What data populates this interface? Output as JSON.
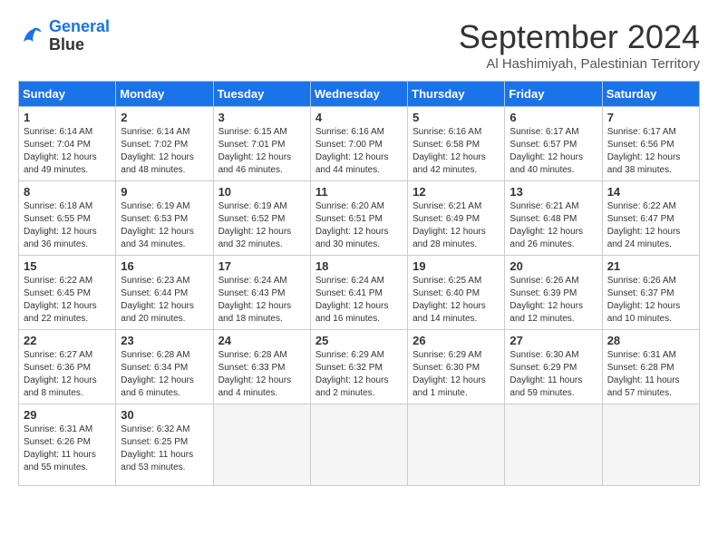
{
  "logo": {
    "line1": "General",
    "line2": "Blue"
  },
  "title": "September 2024",
  "subtitle": "Al Hashimiyah, Palestinian Territory",
  "headers": [
    "Sunday",
    "Monday",
    "Tuesday",
    "Wednesday",
    "Thursday",
    "Friday",
    "Saturday"
  ],
  "weeks": [
    [
      {
        "day": "1",
        "sunrise": "Sunrise: 6:14 AM",
        "sunset": "Sunset: 7:04 PM",
        "daylight": "Daylight: 12 hours and 49 minutes."
      },
      {
        "day": "2",
        "sunrise": "Sunrise: 6:14 AM",
        "sunset": "Sunset: 7:02 PM",
        "daylight": "Daylight: 12 hours and 48 minutes."
      },
      {
        "day": "3",
        "sunrise": "Sunrise: 6:15 AM",
        "sunset": "Sunset: 7:01 PM",
        "daylight": "Daylight: 12 hours and 46 minutes."
      },
      {
        "day": "4",
        "sunrise": "Sunrise: 6:16 AM",
        "sunset": "Sunset: 7:00 PM",
        "daylight": "Daylight: 12 hours and 44 minutes."
      },
      {
        "day": "5",
        "sunrise": "Sunrise: 6:16 AM",
        "sunset": "Sunset: 6:58 PM",
        "daylight": "Daylight: 12 hours and 42 minutes."
      },
      {
        "day": "6",
        "sunrise": "Sunrise: 6:17 AM",
        "sunset": "Sunset: 6:57 PM",
        "daylight": "Daylight: 12 hours and 40 minutes."
      },
      {
        "day": "7",
        "sunrise": "Sunrise: 6:17 AM",
        "sunset": "Sunset: 6:56 PM",
        "daylight": "Daylight: 12 hours and 38 minutes."
      }
    ],
    [
      {
        "day": "8",
        "sunrise": "Sunrise: 6:18 AM",
        "sunset": "Sunset: 6:55 PM",
        "daylight": "Daylight: 12 hours and 36 minutes."
      },
      {
        "day": "9",
        "sunrise": "Sunrise: 6:19 AM",
        "sunset": "Sunset: 6:53 PM",
        "daylight": "Daylight: 12 hours and 34 minutes."
      },
      {
        "day": "10",
        "sunrise": "Sunrise: 6:19 AM",
        "sunset": "Sunset: 6:52 PM",
        "daylight": "Daylight: 12 hours and 32 minutes."
      },
      {
        "day": "11",
        "sunrise": "Sunrise: 6:20 AM",
        "sunset": "Sunset: 6:51 PM",
        "daylight": "Daylight: 12 hours and 30 minutes."
      },
      {
        "day": "12",
        "sunrise": "Sunrise: 6:21 AM",
        "sunset": "Sunset: 6:49 PM",
        "daylight": "Daylight: 12 hours and 28 minutes."
      },
      {
        "day": "13",
        "sunrise": "Sunrise: 6:21 AM",
        "sunset": "Sunset: 6:48 PM",
        "daylight": "Daylight: 12 hours and 26 minutes."
      },
      {
        "day": "14",
        "sunrise": "Sunrise: 6:22 AM",
        "sunset": "Sunset: 6:47 PM",
        "daylight": "Daylight: 12 hours and 24 minutes."
      }
    ],
    [
      {
        "day": "15",
        "sunrise": "Sunrise: 6:22 AM",
        "sunset": "Sunset: 6:45 PM",
        "daylight": "Daylight: 12 hours and 22 minutes."
      },
      {
        "day": "16",
        "sunrise": "Sunrise: 6:23 AM",
        "sunset": "Sunset: 6:44 PM",
        "daylight": "Daylight: 12 hours and 20 minutes."
      },
      {
        "day": "17",
        "sunrise": "Sunrise: 6:24 AM",
        "sunset": "Sunset: 6:43 PM",
        "daylight": "Daylight: 12 hours and 18 minutes."
      },
      {
        "day": "18",
        "sunrise": "Sunrise: 6:24 AM",
        "sunset": "Sunset: 6:41 PM",
        "daylight": "Daylight: 12 hours and 16 minutes."
      },
      {
        "day": "19",
        "sunrise": "Sunrise: 6:25 AM",
        "sunset": "Sunset: 6:40 PM",
        "daylight": "Daylight: 12 hours and 14 minutes."
      },
      {
        "day": "20",
        "sunrise": "Sunrise: 6:26 AM",
        "sunset": "Sunset: 6:39 PM",
        "daylight": "Daylight: 12 hours and 12 minutes."
      },
      {
        "day": "21",
        "sunrise": "Sunrise: 6:26 AM",
        "sunset": "Sunset: 6:37 PM",
        "daylight": "Daylight: 12 hours and 10 minutes."
      }
    ],
    [
      {
        "day": "22",
        "sunrise": "Sunrise: 6:27 AM",
        "sunset": "Sunset: 6:36 PM",
        "daylight": "Daylight: 12 hours and 8 minutes."
      },
      {
        "day": "23",
        "sunrise": "Sunrise: 6:28 AM",
        "sunset": "Sunset: 6:34 PM",
        "daylight": "Daylight: 12 hours and 6 minutes."
      },
      {
        "day": "24",
        "sunrise": "Sunrise: 6:28 AM",
        "sunset": "Sunset: 6:33 PM",
        "daylight": "Daylight: 12 hours and 4 minutes."
      },
      {
        "day": "25",
        "sunrise": "Sunrise: 6:29 AM",
        "sunset": "Sunset: 6:32 PM",
        "daylight": "Daylight: 12 hours and 2 minutes."
      },
      {
        "day": "26",
        "sunrise": "Sunrise: 6:29 AM",
        "sunset": "Sunset: 6:30 PM",
        "daylight": "Daylight: 12 hours and 1 minute."
      },
      {
        "day": "27",
        "sunrise": "Sunrise: 6:30 AM",
        "sunset": "Sunset: 6:29 PM",
        "daylight": "Daylight: 11 hours and 59 minutes."
      },
      {
        "day": "28",
        "sunrise": "Sunrise: 6:31 AM",
        "sunset": "Sunset: 6:28 PM",
        "daylight": "Daylight: 11 hours and 57 minutes."
      }
    ],
    [
      {
        "day": "29",
        "sunrise": "Sunrise: 6:31 AM",
        "sunset": "Sunset: 6:26 PM",
        "daylight": "Daylight: 11 hours and 55 minutes."
      },
      {
        "day": "30",
        "sunrise": "Sunrise: 6:32 AM",
        "sunset": "Sunset: 6:25 PM",
        "daylight": "Daylight: 11 hours and 53 minutes."
      },
      null,
      null,
      null,
      null,
      null
    ]
  ]
}
